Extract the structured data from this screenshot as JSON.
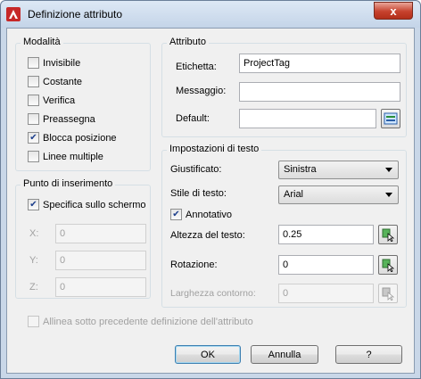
{
  "window": {
    "title": "Definizione attributo",
    "close_label": "x"
  },
  "modalita": {
    "label": "Modalità",
    "items": [
      {
        "label": "Invisibile",
        "checked": false
      },
      {
        "label": "Costante",
        "checked": false
      },
      {
        "label": "Verifica",
        "checked": false
      },
      {
        "label": "Preassegna",
        "checked": false
      },
      {
        "label": "Blocca posizione",
        "checked": true
      },
      {
        "label": "Linee multiple",
        "checked": false
      }
    ]
  },
  "attributo": {
    "label": "Attributo",
    "etichetta_label": "Etichetta:",
    "etichetta_value": "ProjectTag",
    "messaggio_label": "Messaggio:",
    "messaggio_value": "",
    "default_label": "Default:",
    "default_value": ""
  },
  "punto": {
    "label": "Punto di inserimento",
    "specifica_label": "Specifica sullo schermo",
    "specifica_checked": true,
    "x_label": "X:",
    "x_value": "0",
    "y_label": "Y:",
    "y_value": "0",
    "z_label": "Z:",
    "z_value": "0"
  },
  "testo": {
    "label": "Impostazioni di testo",
    "giustificato_label": "Giustificato:",
    "giustificato_value": "Sinistra",
    "stile_label": "Stile di testo:",
    "stile_value": "Arial",
    "annotativo_label": "Annotativo",
    "annotativo_checked": true,
    "altezza_label": "Altezza del testo:",
    "altezza_value": "0.25",
    "rotazione_label": "Rotazione:",
    "rotazione_value": "0",
    "larghezza_label": "Larghezza contorno:",
    "larghezza_value": "0"
  },
  "allinea_label": "Allinea sotto precedente definizione dell'attributo",
  "buttons": {
    "ok": "OK",
    "annulla": "Annulla",
    "help": "?"
  },
  "colors": {
    "title_bg": "#c4d4e8",
    "close_red": "#c6412d",
    "client_bg": "#f0f0f0"
  }
}
